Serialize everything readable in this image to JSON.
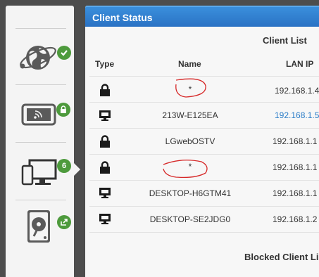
{
  "sidebar": {
    "items": [
      {
        "icon": "internet-globe-icon",
        "badge_icon": "check-icon",
        "badge_color": "#4d9a3c"
      },
      {
        "icon": "wireless-tablet-icon",
        "badge_icon": "lock-icon",
        "badge_color": "#4d9a3c"
      },
      {
        "icon": "devices-icon",
        "badge": "6",
        "badge_color": "#4d9a3c"
      },
      {
        "icon": "hard-drive-icon",
        "badge_icon": "external-link-icon",
        "badge_color": "#4d9a3c"
      }
    ]
  },
  "panel": {
    "title": "Client Status",
    "header_color": "#2f7fd1",
    "client_list_title": "Client List",
    "blocked_list_title": "Blocked Client Li",
    "columns": {
      "type": "Type",
      "name": "Name",
      "ip": "LAN IP"
    }
  },
  "clients": [
    {
      "type": "lock-icon",
      "name": "*",
      "ip": "192.168.1.4",
      "ip_link": false
    },
    {
      "type": "monitor-icon",
      "name": "213W-E125EA",
      "ip": "192.168.1.5",
      "ip_link": true
    },
    {
      "type": "lock-icon",
      "name": "LGwebOSTV",
      "ip": "192.168.1.1",
      "ip_link": false
    },
    {
      "type": "lock-icon",
      "name": "*",
      "ip": "192.168.1.1",
      "ip_link": false
    },
    {
      "type": "monitor-icon",
      "name": "DESKTOP-H6GTM41",
      "ip": "192.168.1.1",
      "ip_link": false
    },
    {
      "type": "monitor-icon",
      "name": "DESKTOP-SE2JDG0",
      "ip": "192.168.1.2",
      "ip_link": false
    }
  ]
}
